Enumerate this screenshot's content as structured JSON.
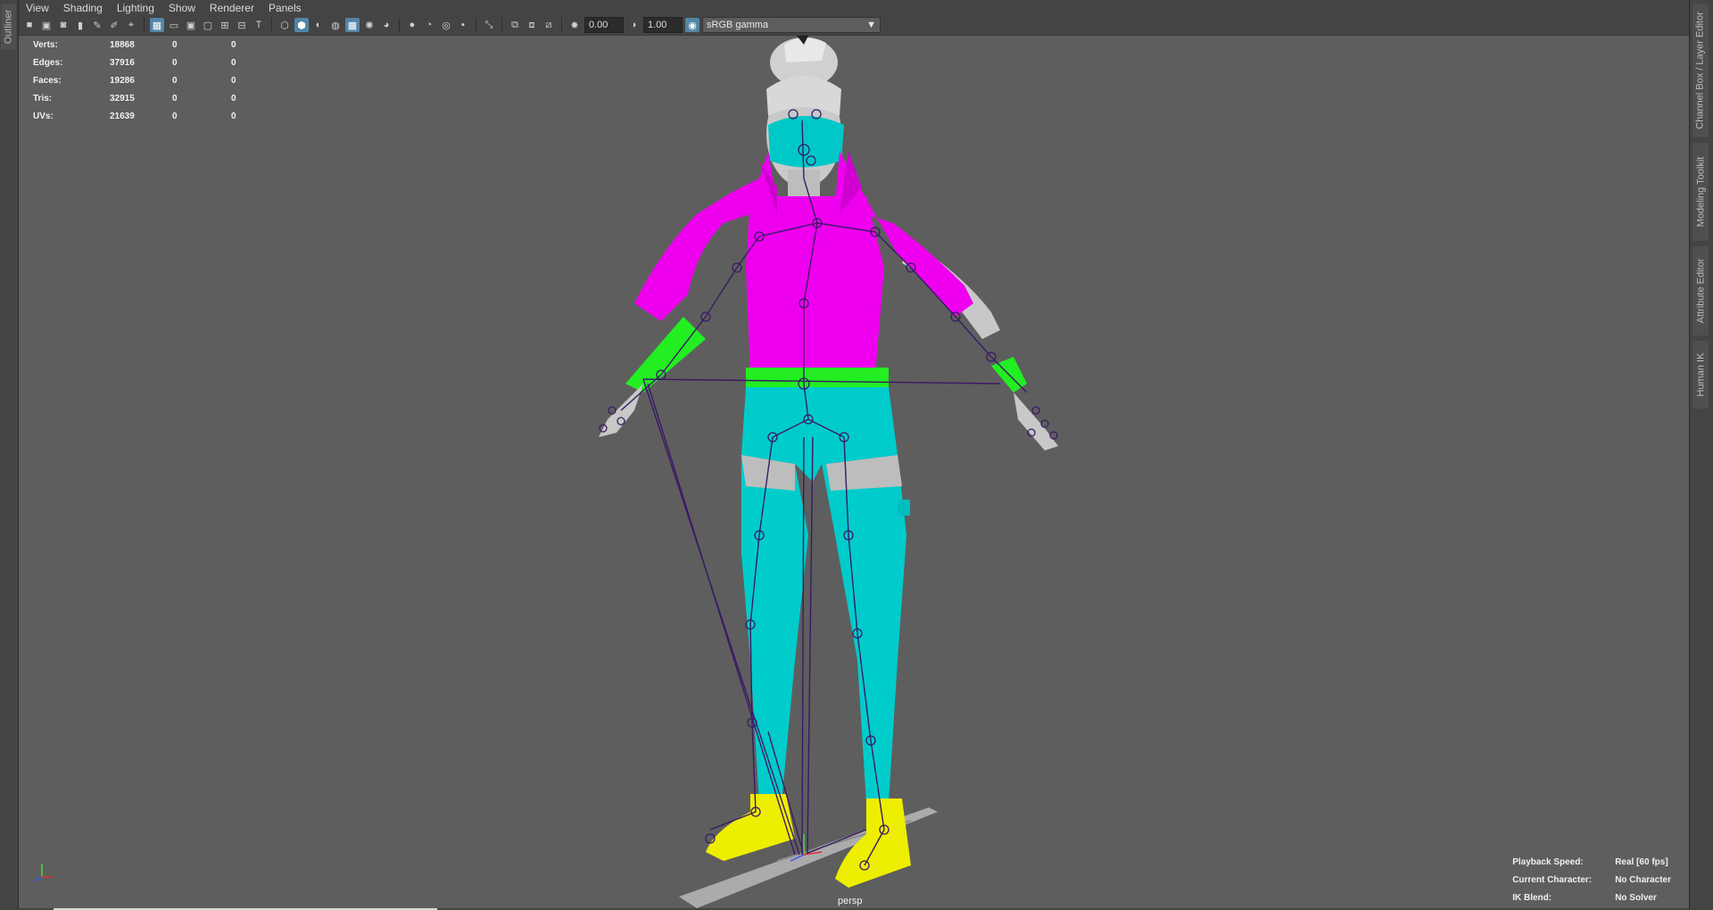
{
  "left_panel": {
    "outliner_tab": "Outliner"
  },
  "right_panel": {
    "tabs": [
      "Channel Box / Layer Editor",
      "Modeling Toolkit",
      "Attribute Editor",
      "Human IK"
    ]
  },
  "menubar": {
    "items": [
      "View",
      "Shading",
      "Lighting",
      "Show",
      "Renderer",
      "Panels"
    ]
  },
  "toolbar": {
    "exposure_value": "0.00",
    "gamma_value": "1.00",
    "color_space": "sRGB gamma"
  },
  "hud": {
    "stats": [
      {
        "label": "Verts:",
        "v1": "18868",
        "v2": "0",
        "v3": "0"
      },
      {
        "label": "Edges:",
        "v1": "37916",
        "v2": "0",
        "v3": "0"
      },
      {
        "label": "Faces:",
        "v1": "19286",
        "v2": "0",
        "v3": "0"
      },
      {
        "label": "Tris:",
        "v1": "32915",
        "v2": "0",
        "v3": "0"
      },
      {
        "label": "UVs:",
        "v1": "21639",
        "v2": "0",
        "v3": "0"
      }
    ],
    "info": [
      {
        "label": "Playback Speed:",
        "value": "Real [60 fps]"
      },
      {
        "label": "Current Character:",
        "value": "No Character"
      },
      {
        "label": "IK Blend:",
        "value": "No Solver"
      }
    ],
    "camera": "persp"
  },
  "colors": {
    "jacket": "#ee00ee",
    "pants": "#00cccc",
    "gloves": "#22ee22",
    "shoes": "#eeee00",
    "skin": "#c8c8c8",
    "joints": "#3a1a66",
    "viewport_bg": "#5e5e5e"
  }
}
